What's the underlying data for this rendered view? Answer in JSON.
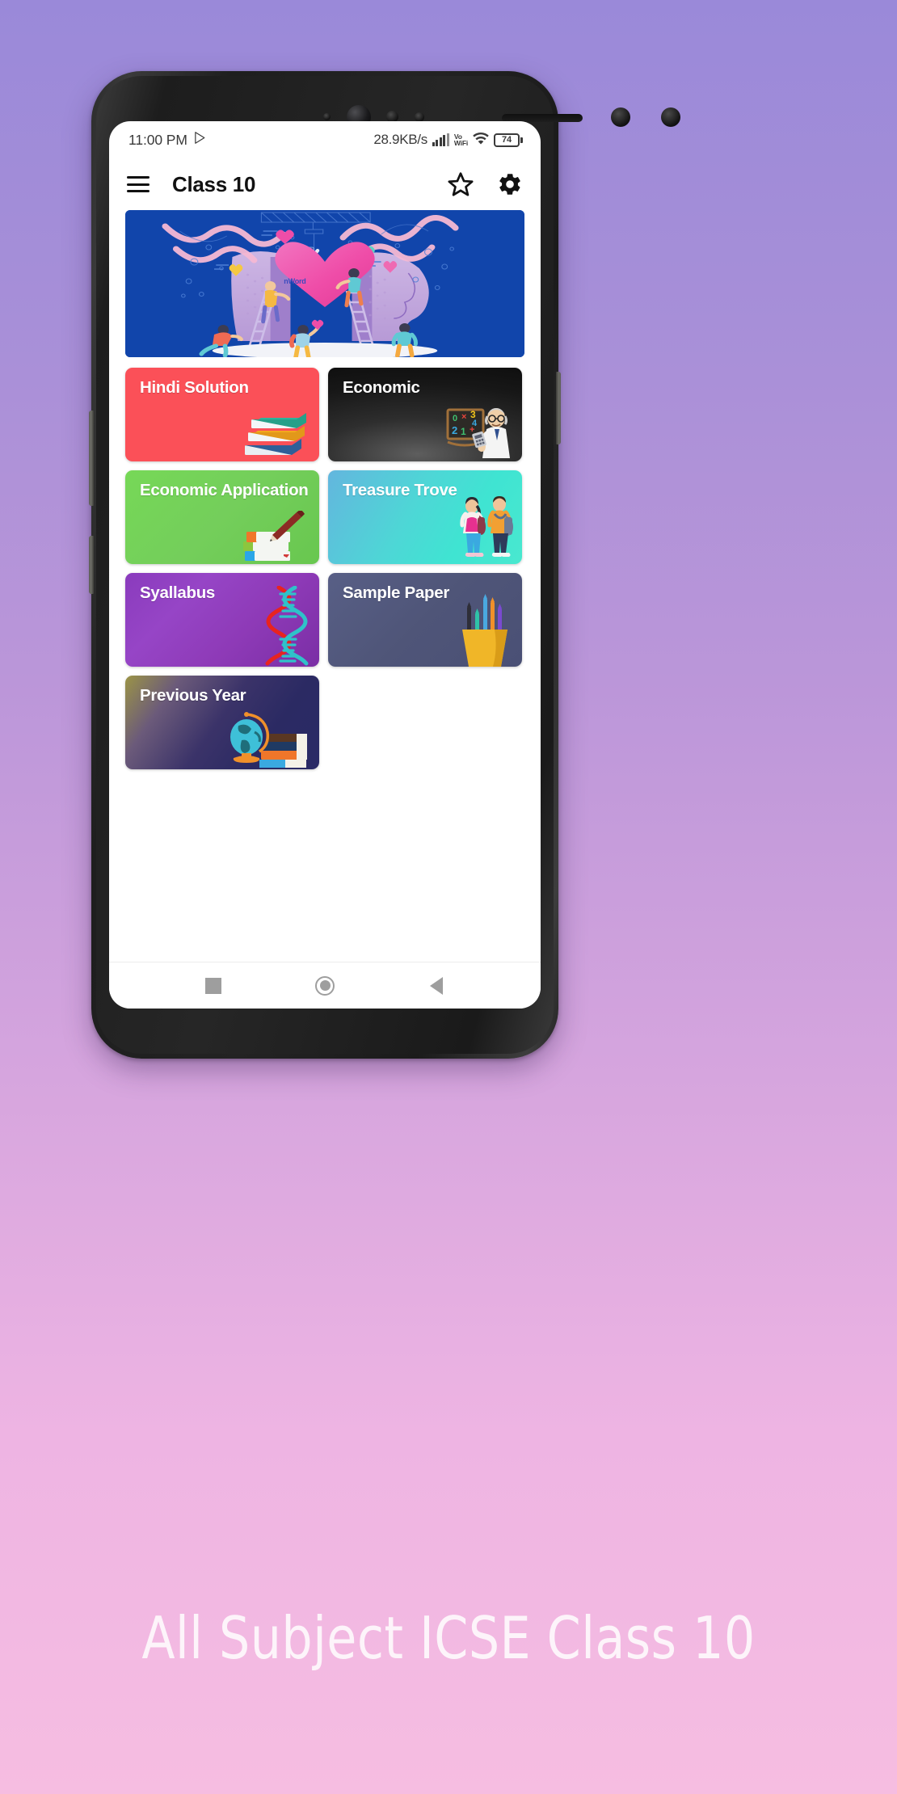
{
  "background": {
    "gradient_top": "#9a89d9",
    "gradient_bottom": "#f6bde1"
  },
  "status_bar": {
    "time": "11:00 PM",
    "play_icon": "play-store-icon",
    "net_speed": "28.9KB/s",
    "signal_icon": "signal-bars-icon",
    "volte_line1": "Vo",
    "volte_line2": "WiFi",
    "wifi_icon": "wifi-icon",
    "battery_level": "74"
  },
  "app_bar": {
    "menu_icon": "hamburger-menu-icon",
    "title": "Class 10",
    "star_icon": "star-outline-icon",
    "settings_icon": "gear-icon"
  },
  "banner": {
    "name": "promo-banner",
    "background_color": "#1145ab",
    "heart_label": "nWord",
    "alt": "Two profile heads with a large pink heart, ladders, ribbons and people illustration"
  },
  "grid": {
    "cards": [
      {
        "id": "hindi-solution",
        "label": "Hindi Solution",
        "color": "#fb5058",
        "art": "stacked-books-icon"
      },
      {
        "id": "economic",
        "label": "Economic",
        "color": "#171717",
        "art": "professor-math-board-icon"
      },
      {
        "id": "economic-application",
        "label": "Economic Application",
        "color": "#74ce5b",
        "art": "books-with-pencil-icon"
      },
      {
        "id": "treasure-trove",
        "label": "Treasure Trove",
        "color": "#3fe4d2",
        "art": "two-students-icon"
      },
      {
        "id": "syallabus",
        "label": "Syallabus",
        "color": "#8e3ab7",
        "art": "dna-helix-icon"
      },
      {
        "id": "sample-paper",
        "label": "Sample Paper",
        "color": "#4f5578",
        "art": "pencil-cup-icon"
      },
      {
        "id": "previous-year",
        "label": "Previous Year",
        "color": "#2b2a63",
        "art": "globe-and-books-icon"
      }
    ]
  },
  "nav_bar": {
    "recents": "recents-square-icon",
    "home": "home-circle-icon",
    "back": "back-triangle-icon"
  },
  "caption": {
    "text": "All Subject ICSE Class 10"
  }
}
